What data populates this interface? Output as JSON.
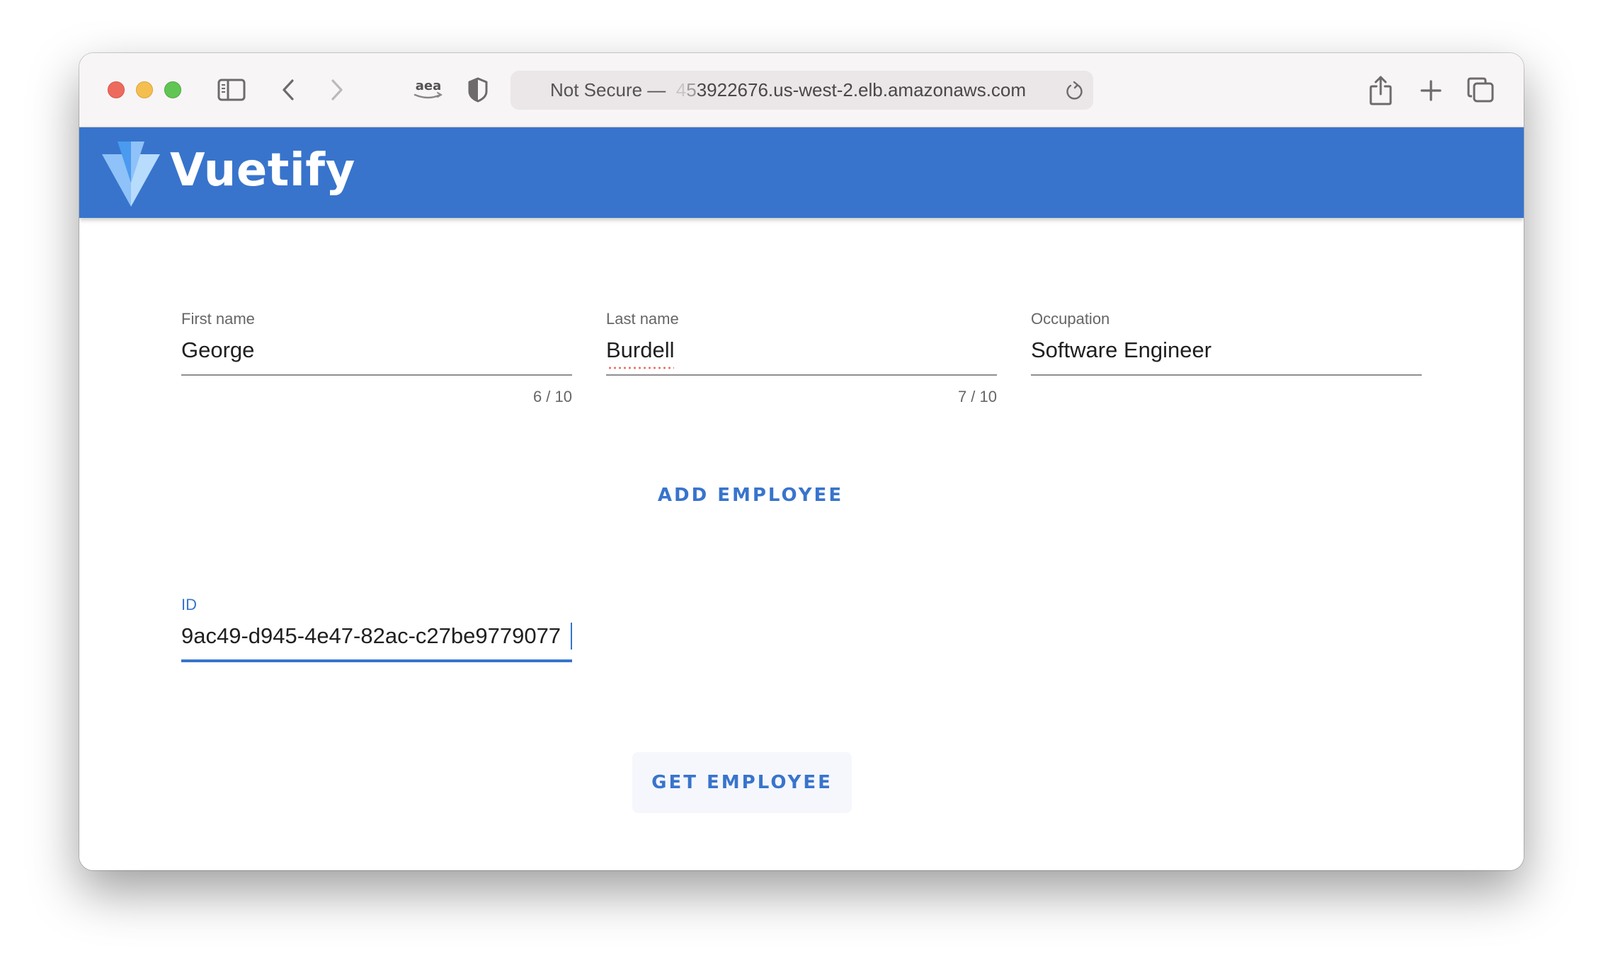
{
  "browser": {
    "address": {
      "security_label": "Not Secure —",
      "url_faded_1": "4",
      "url_faded_2": "5",
      "url_main": "3922676.us-west-2.elb.amazonaws.com"
    },
    "extension_label": "aea",
    "icons": {
      "close": "close-window-button",
      "minimize": "minimize-window-button",
      "zoom": "zoom-window-button",
      "sidebar": "sidebar-icon",
      "back": "chevron-left-icon",
      "forward": "chevron-right-icon",
      "extension": "amazon-extension-icon",
      "privacy": "shield-icon",
      "reload": "reload-icon",
      "share": "share-icon",
      "new_tab": "plus-icon",
      "tab_overview": "tabs-icon"
    }
  },
  "app": {
    "title": "Vuetify",
    "colors": {
      "primary": "#3874cc",
      "logo_light": "#b7dcfc",
      "logo_mid": "#8ec2f8",
      "logo_dark": "#4a9af0"
    }
  },
  "form": {
    "first_name": {
      "label": "First name",
      "value": "George",
      "counter": "6 / 10"
    },
    "last_name": {
      "label": "Last name",
      "value": "Burdell",
      "counter": "7 / 10"
    },
    "occupation": {
      "label": "Occupation",
      "value": "Software Engineer"
    },
    "add_button": "ADD EMPLOYEE",
    "id_field": {
      "label": "ID",
      "value": "9ac49-d945-4e47-82ac-c27be9779077"
    },
    "get_button": "GET EMPLOYEE"
  }
}
